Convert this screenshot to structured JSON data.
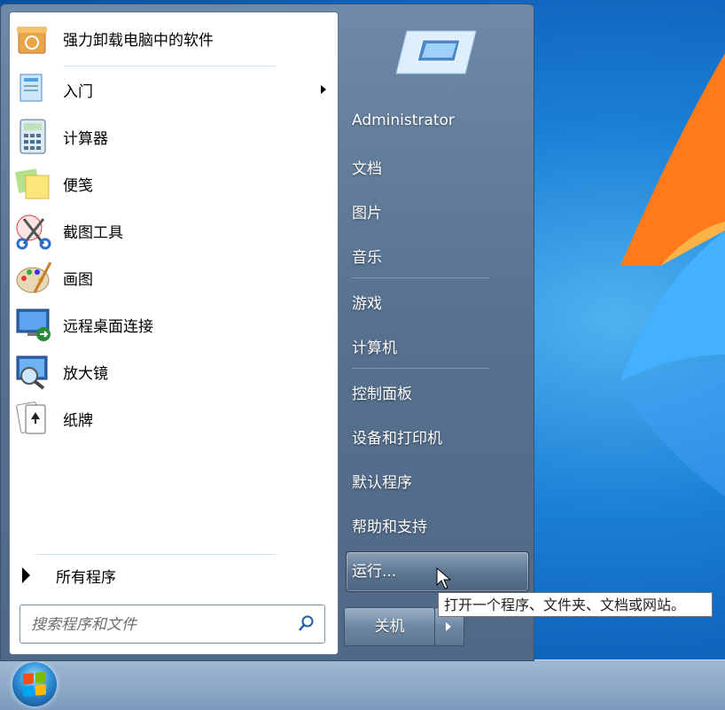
{
  "start_menu": {
    "programs": [
      {
        "label": "强力卸载电脑中的软件",
        "icon": "uninstall-box-icon"
      },
      {
        "label": "入门",
        "icon": "getting-started-icon",
        "has_submenu": true
      },
      {
        "label": "计算器",
        "icon": "calculator-icon"
      },
      {
        "label": "便笺",
        "icon": "sticky-notes-icon"
      },
      {
        "label": "截图工具",
        "icon": "snipping-tool-icon"
      },
      {
        "label": "画图",
        "icon": "paint-palette-icon"
      },
      {
        "label": "远程桌面连接",
        "icon": "remote-desktop-icon"
      },
      {
        "label": "放大镜",
        "icon": "magnifier-icon"
      },
      {
        "label": "纸牌",
        "icon": "solitaire-cards-icon"
      }
    ],
    "all_programs": "所有程序",
    "search": {
      "placeholder": "搜索程序和文件"
    },
    "right_links": [
      "Administrator",
      "文档",
      "图片",
      "音乐",
      "游戏",
      "计算机",
      "控制面板",
      "设备和打印机",
      "默认程序",
      "帮助和支持",
      "运行..."
    ],
    "shutdown_label": "关机",
    "tooltip": "打开一个程序、文件夹、文档或网站。"
  },
  "colors": {
    "accent": "#1b7fd6",
    "menu_frame": "#56718f",
    "left_pane": "#ffffff"
  }
}
